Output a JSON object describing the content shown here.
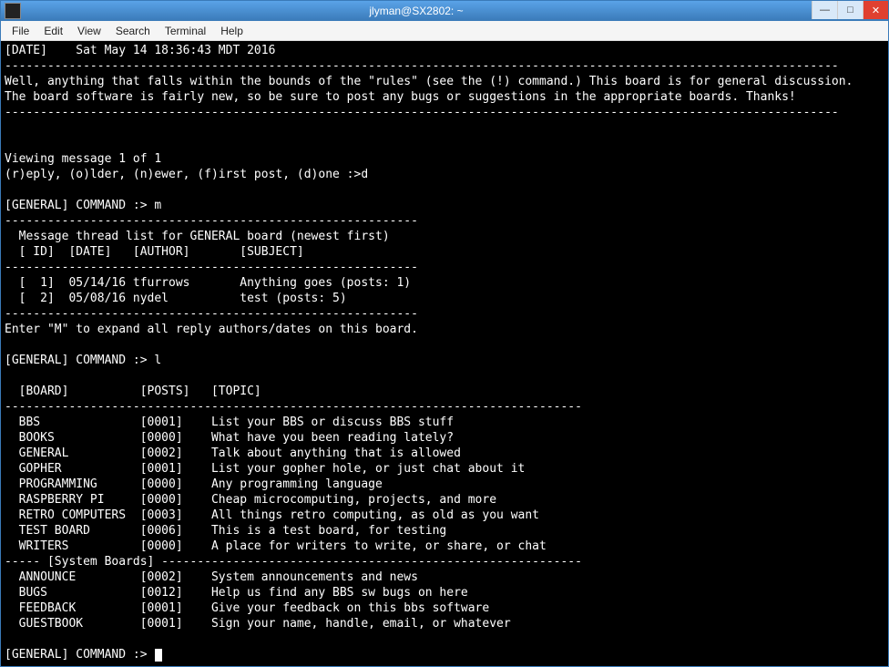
{
  "window": {
    "title": "jlyman@SX2802: ~"
  },
  "menubar": {
    "items": [
      "File",
      "Edit",
      "View",
      "Search",
      "Terminal",
      "Help"
    ]
  },
  "terminal": {
    "date_line": "[DATE]    Sat May 14 18:36:43 MDT 2016",
    "sep_long": "---------------------------------------------------------------------------------------------------------------------",
    "msg_line1": "Well, anything that falls within the bounds of the \"rules\" (see the (!) command.) This board is for general discussion.",
    "msg_line2": "The board software is fairly new, so be sure to post any bugs or suggestions in the appropriate boards. Thanks!",
    "blank": "",
    "viewing": "Viewing message 1 of 1",
    "nav_prompt": "(r)eply, (o)lder, (n)ewer, (f)irst post, (d)one :>d",
    "cmd_m": "[GENERAL] COMMAND :> m",
    "sep_mid": "----------------------------------------------------------",
    "thread_header": "  Message thread list for GENERAL board (newest first)",
    "thread_cols": "  [ ID]  [DATE]   [AUTHOR]       [SUBJECT]",
    "thread_row1": "  [  1]  05/14/16 tfurrows       Anything goes (posts: 1)",
    "thread_row2": "  [  2]  05/08/16 nydel          test (posts: 5)",
    "expand_hint": "Enter \"M\" to expand all reply authors/dates on this board.",
    "cmd_l": "[GENERAL] COMMAND :> l",
    "board_cols": "  [BOARD]          [POSTS]   [TOPIC]",
    "sep_boards": "---------------------------------------------------------------------------------",
    "board_bbs": "  BBS              [0001]    List your BBS or discuss BBS stuff",
    "board_books": "  BOOKS            [0000]    What have you been reading lately?",
    "board_general": "  GENERAL          [0002]    Talk about anything that is allowed",
    "board_gopher": "  GOPHER           [0001]    List your gopher hole, or just chat about it",
    "board_prog": "  PROGRAMMING      [0000]    Any programming language",
    "board_rpi": "  RASPBERRY PI     [0000]    Cheap microcomputing, projects, and more",
    "board_retro": "  RETRO COMPUTERS  [0003]    All things retro computing, as old as you want",
    "board_test": "  TEST BOARD       [0006]    This is a test board, for testing",
    "board_writers": "  WRITERS          [0000]    A place for writers to write, or share, or chat",
    "sys_sep": "----- [System Boards] -----------------------------------------------------------",
    "board_announce": "  ANNOUNCE         [0002]    System announcements and news",
    "board_bugs": "  BUGS             [0012]    Help us find any BBS sw bugs on here",
    "board_feedback": "  FEEDBACK         [0001]    Give your feedback on this bbs software",
    "board_guestbook": "  GUESTBOOK        [0001]    Sign your name, handle, email, or whatever",
    "cmd_prompt": "[GENERAL] COMMAND :>"
  }
}
